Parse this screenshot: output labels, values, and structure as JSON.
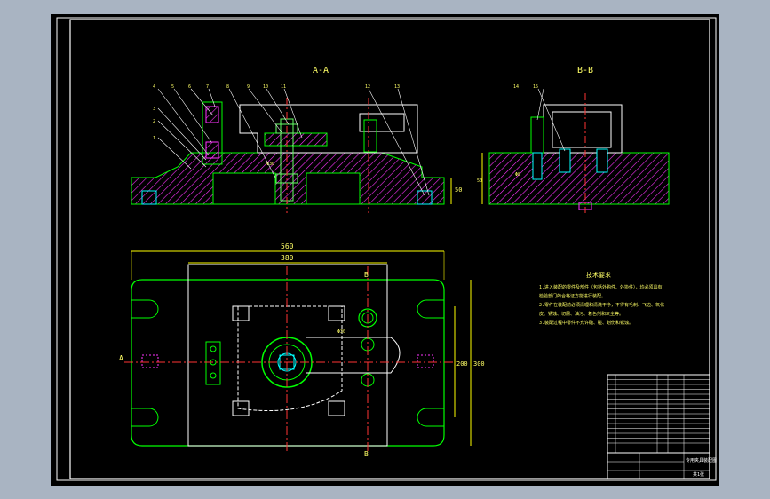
{
  "colors": {
    "background": "#a9b4c2",
    "sheet": "#000000",
    "frame": "#ffffff",
    "part_outline": "#00ff00",
    "hatch": "#ff33ff",
    "dimension": "#ffff00",
    "centerline": "#ff3333",
    "fastener": "#00ffff",
    "bolt": "#66ff66"
  },
  "views": {
    "section_aa_label": "A-A",
    "section_bb_label": "B-B",
    "cut_mark_a": "A",
    "cut_mark_b": "B"
  },
  "balloons": [
    "4",
    "5",
    "6",
    "7",
    "8",
    "9",
    "10",
    "11",
    "3",
    "2",
    "1",
    "12",
    "13",
    "14",
    "15"
  ],
  "dimensions": {
    "overall_length": "560",
    "inner_length": "380",
    "overall_height": "300",
    "inner_height": "200",
    "bore_dim": "Φ30",
    "bb_height": "50",
    "aa_height": "50",
    "hole_dim": "Φ8"
  },
  "notes": {
    "title": "技术要求",
    "lines": [
      "1.进入装配的零件及部件（包括外购件、外协件），均必须具有",
      "检验部门的合格证方能进行装配。",
      "2.零件在装配前必须清理和清洗干净，不得有毛刺、飞边、氧化",
      "皮、锈蚀、切屑、油污、着色剂和灰尘等。",
      "3.装配过程中零件不允许磕、碰、划伤和锈蚀。"
    ]
  },
  "title_block": {
    "rows": 16,
    "drawing_name": "专用夹具装配图",
    "sheet_label": "共1张"
  }
}
